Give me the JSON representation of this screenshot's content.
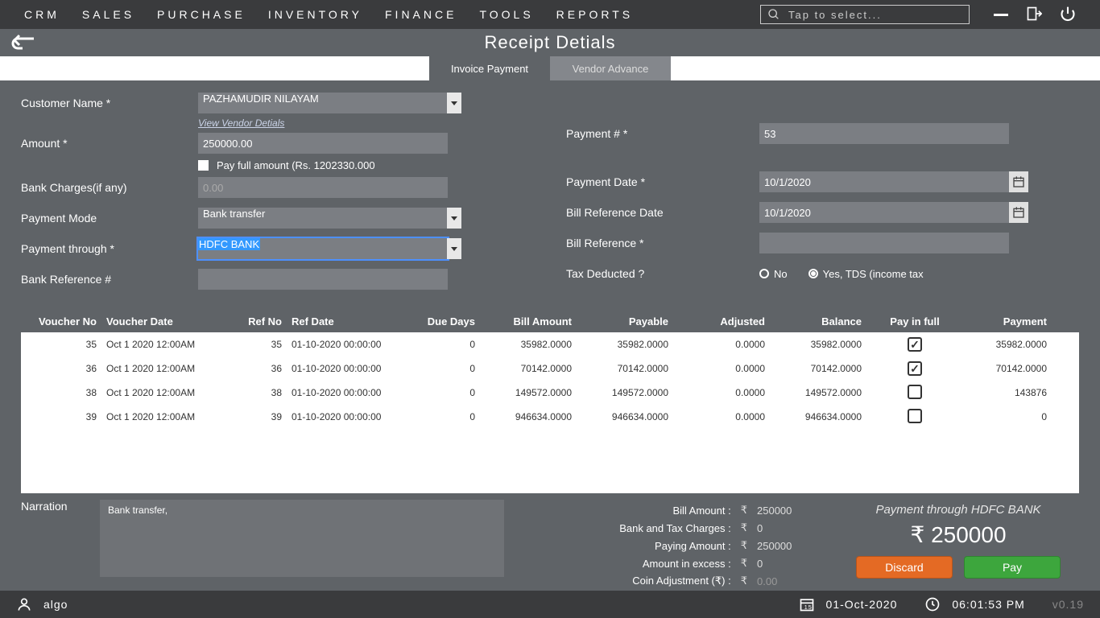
{
  "menu": [
    "CRM",
    "SALES",
    "PURCHASE",
    "INVENTORY",
    "FINANCE",
    "TOOLS",
    "REPORTS"
  ],
  "search_placeholder": "Tap to select...",
  "page_title": "Receipt Detials",
  "tabs": {
    "invoice": "Invoice Payment",
    "advance": "Vendor Advance"
  },
  "form": {
    "customer_label": "Customer Name *",
    "customer_value": "PAZHAMUDIR NILAYAM",
    "view_vendor_link": "View Vendor Detials",
    "amount_label": "Amount *",
    "amount_value": "250000.00",
    "pay_full_text": "Pay full amount (Rs. 1202330.000",
    "bank_charges_label": "Bank Charges(if any)",
    "bank_charges_value": "0.00",
    "payment_mode_label": "Payment Mode",
    "payment_mode_value": "Bank transfer",
    "payment_through_label": "Payment through *",
    "payment_through_value": "HDFC BANK",
    "bank_ref_label": "Bank Reference #",
    "bank_ref_value": "",
    "payment_no_label": "Payment # *",
    "payment_no_value": "53",
    "payment_date_label": "Payment Date *",
    "payment_date_value": "10/1/2020",
    "bill_ref_date_label": "Bill Reference Date",
    "bill_ref_date_value": "10/1/2020",
    "bill_ref_label": "Bill Reference *",
    "bill_ref_value": "",
    "tax_label": "Tax Deducted ?",
    "tax_no": "No",
    "tax_yes": "Yes,  TDS  (income tax"
  },
  "table": {
    "headers": {
      "vno": "Voucher No",
      "vdate": "Voucher Date",
      "refno": "Ref No",
      "refdate": "Ref Date",
      "due": "Due Days",
      "bill": "Bill Amount",
      "payable": "Payable",
      "adj": "Adjusted",
      "bal": "Balance",
      "pif": "Pay in full",
      "pmt": "Payment"
    },
    "rows": [
      {
        "vno": "35",
        "vdate": "Oct  1 2020 12:00AM",
        "refno": "35",
        "refdate": "01-10-2020 00:00:00",
        "due": "0",
        "bill": "35982.0000",
        "payable": "35982.0000",
        "adj": "0.0000",
        "bal": "35982.0000",
        "pif": true,
        "pmt": "35982.0000"
      },
      {
        "vno": "36",
        "vdate": "Oct  1 2020 12:00AM",
        "refno": "36",
        "refdate": "01-10-2020 00:00:00",
        "due": "0",
        "bill": "70142.0000",
        "payable": "70142.0000",
        "adj": "0.0000",
        "bal": "70142.0000",
        "pif": true,
        "pmt": "70142.0000"
      },
      {
        "vno": "38",
        "vdate": "Oct  1 2020 12:00AM",
        "refno": "38",
        "refdate": "01-10-2020 00:00:00",
        "due": "0",
        "bill": "149572.0000",
        "payable": "149572.0000",
        "adj": "0.0000",
        "bal": "149572.0000",
        "pif": false,
        "pmt": "143876"
      },
      {
        "vno": "39",
        "vdate": "Oct  1 2020 12:00AM",
        "refno": "39",
        "refdate": "01-10-2020 00:00:00",
        "due": "0",
        "bill": "946634.0000",
        "payable": "946634.0000",
        "adj": "0.0000",
        "bal": "946634.0000",
        "pif": false,
        "pmt": "0"
      }
    ]
  },
  "narration": {
    "label": "Narration",
    "text": "Bank transfer,"
  },
  "totals": {
    "bill_amount_lbl": "Bill Amount  :",
    "bill_amount_val": "250000",
    "bank_tax_lbl": "Bank and Tax Charges  :",
    "bank_tax_val": "0",
    "paying_lbl": "Paying Amount  :",
    "paying_val": "250000",
    "excess_lbl": "Amount in excess  :",
    "excess_val": "0",
    "coin_lbl": "Coin Adjustment (₹)  :",
    "coin_val": "0.00"
  },
  "pay_panel": {
    "through": "Payment through HDFC BANK",
    "amount": "₹  250000",
    "discard": "Discard",
    "pay": "Pay"
  },
  "status": {
    "user": "algo",
    "date": "01-Oct-2020",
    "time": "06:01:53 PM",
    "version": "v0.19"
  }
}
